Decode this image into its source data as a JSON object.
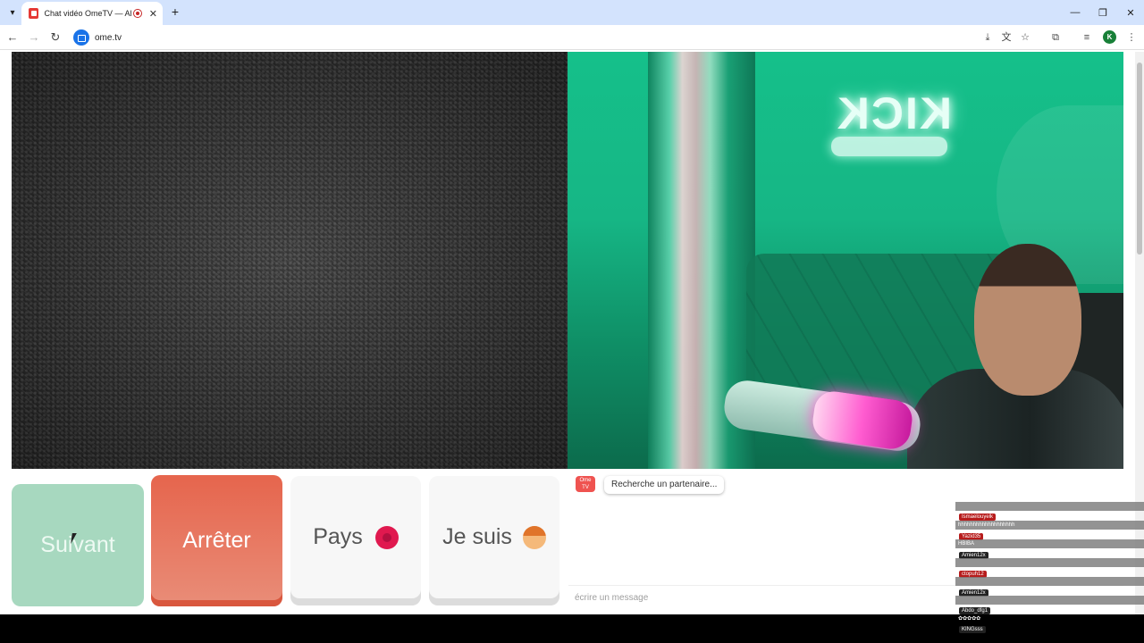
{
  "browser": {
    "tab_title": "Chat vidéo OmeTV — Alter",
    "tab_list_icon": "chevron-down-icon",
    "new_tab": "+",
    "close_tab": "✕",
    "minimize": "—",
    "restore": "❐",
    "close_window": "✕",
    "url": "ome.tv",
    "profile_initial": "K"
  },
  "toolbar": {
    "back": "←",
    "forward": "→",
    "reload": "↻",
    "install": "⤓",
    "translate": "文",
    "bookmark": "☆",
    "extensions": "⧉",
    "media": "≡",
    "menu": "⋮"
  },
  "controls": {
    "next_label": "Suivant",
    "stop_label": "Arrêter",
    "country_label": "Pays",
    "iam_label": "Je suis"
  },
  "chat": {
    "logo_text": "Ome TV",
    "status": "Recherche un partenaire...",
    "input_placeholder": "écrire un message"
  },
  "video_right": {
    "neon_text": "KICK"
  },
  "overlay_chat": [
    {
      "user": "",
      "message": ""
    },
    {
      "user": "Ismaelouyelk",
      "message": "hhhhhhhhhhhhhhhhhhh"
    },
    {
      "user": "Yazid35",
      "message": "HBIBA"
    },
    {
      "user": "Amien12x",
      "message": ""
    },
    {
      "user": "ctopuh12",
      "message": ""
    },
    {
      "user": "Amien12x",
      "message": ""
    },
    {
      "user": "Abdo_dfg1",
      "message": "✿✿✿✿✿"
    },
    {
      "user": "KINGsss",
      "message": ""
    }
  ],
  "colors": {
    "next": "#a7d8bf",
    "stop": "#e6654d",
    "accent_green": "#15c08a"
  }
}
